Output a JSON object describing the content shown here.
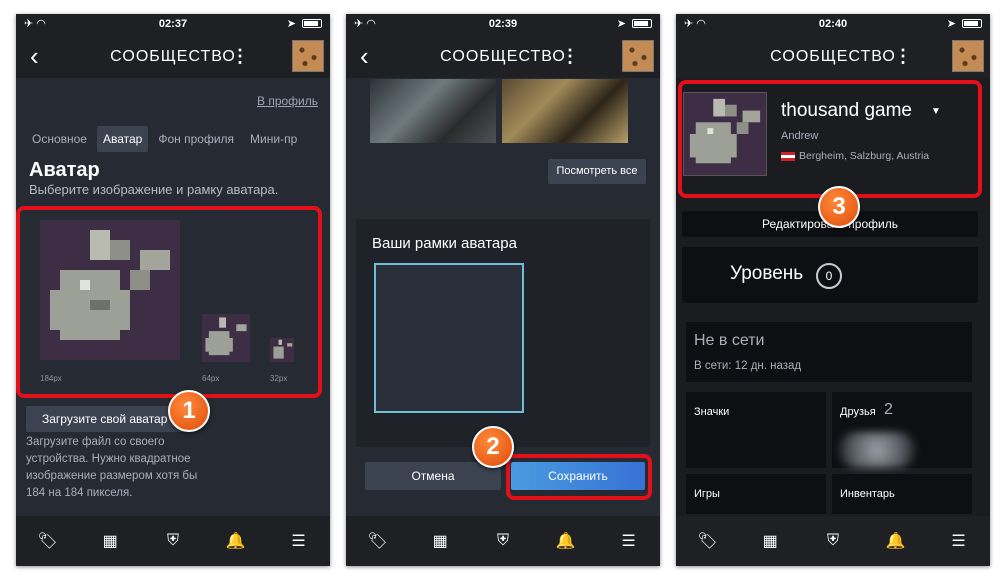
{
  "phones": [
    {
      "status": {
        "time": "02:37"
      },
      "header": {
        "title": "СООБЩЕСТВО"
      },
      "profile_link": "В профиль",
      "tabs": [
        "Основное",
        "Аватар",
        "Фон профиля",
        "Мини-пр"
      ],
      "section_title": "Аватар",
      "section_subtitle": "Выберите изображение и рамку аватара.",
      "sizes": [
        "184px",
        "64px",
        "32px"
      ],
      "upload_button": "Загрузите свой аватар",
      "upload_hint": "Загрузите файл со своего устройства. Нужно квадратное изображение размером хотя бы 184 на 184 пикселя.",
      "step": "1"
    },
    {
      "status": {
        "time": "02:39"
      },
      "header": {
        "title": "СООБЩЕСТВО"
      },
      "view_all": "Посмотреть все",
      "frames_title": "Ваши рамки аватара",
      "cancel": "Отмена",
      "save": "Сохранить",
      "step": "2"
    },
    {
      "status": {
        "time": "02:40"
      },
      "header": {
        "title": "СООБЩЕСТВО"
      },
      "name": "thousand game",
      "real_name": "Andrew",
      "location": "Bergheim, Salzburg, Austria",
      "edit_profile": "Редактировать профиль",
      "level_label": "Уровень",
      "level_value": "0",
      "status_title": "Не в сети",
      "status_sub": "В сети: 12 дн. назад",
      "tiles": {
        "badges": "Значки",
        "friends": "Друзья",
        "friends_count": "2",
        "games": "Игры",
        "inventory": "Инвентарь"
      },
      "step": "3"
    }
  ],
  "colors": {
    "accent_red": "#e3101a",
    "badge_orange": "#f06a1a",
    "save_blue": "#3d86dc"
  },
  "icons": [
    "airplane-icon",
    "wifi-icon",
    "location-arrow-icon",
    "battery-icon",
    "back-icon",
    "more-icon",
    "tag-icon",
    "grid-icon",
    "shield-icon",
    "bell-icon",
    "menu-icon"
  ]
}
